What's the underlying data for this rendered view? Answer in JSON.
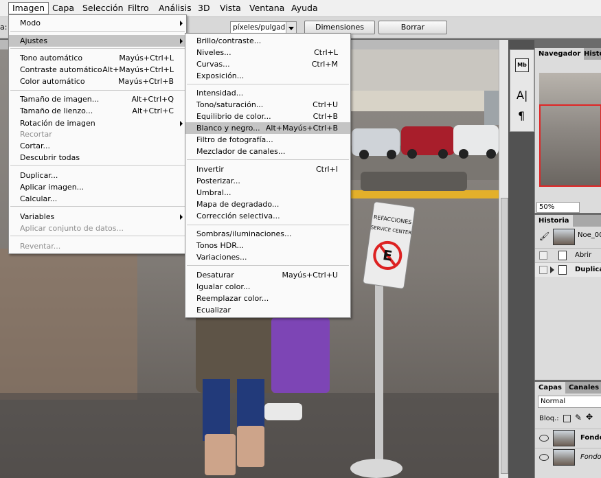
{
  "menubar": {
    "items": [
      "Imagen",
      "Capa",
      "Selección",
      "Filtro",
      "Análisis",
      "3D",
      "Vista",
      "Ventana",
      "Ayuda"
    ],
    "active": "Imagen"
  },
  "optbar": {
    "unit_select": "píxeles/pulgada",
    "dimensions_button": "Dimensiones",
    "clear_button": "Borrar",
    "left_label": "a:"
  },
  "imagen_menu": {
    "items": [
      {
        "label": "Modo",
        "shortcut": "",
        "submenu": true
      },
      {
        "label": "Ajustes",
        "shortcut": "",
        "submenu": true,
        "highlight": true
      },
      {
        "label": "Tono automático",
        "shortcut": "Mayús+Ctrl+L"
      },
      {
        "label": "Contraste automático",
        "shortcut": "Alt+Mayús+Ctrl+L"
      },
      {
        "label": "Color automático",
        "shortcut": "Mayús+Ctrl+B"
      },
      {
        "label": "Tamaño de imagen...",
        "shortcut": "Alt+Ctrl+Q"
      },
      {
        "label": "Tamaño de lienzo...",
        "shortcut": "Alt+Ctrl+C"
      },
      {
        "label": "Rotación de imagen",
        "shortcut": "",
        "submenu": true
      },
      {
        "label": "Recortar",
        "shortcut": "",
        "disabled": true
      },
      {
        "label": "Cortar...",
        "shortcut": ""
      },
      {
        "label": "Descubrir todas",
        "shortcut": ""
      },
      {
        "label": "Duplicar...",
        "shortcut": ""
      },
      {
        "label": "Aplicar imagen...",
        "shortcut": ""
      },
      {
        "label": "Calcular...",
        "shortcut": ""
      },
      {
        "label": "Variables",
        "shortcut": "",
        "submenu": true
      },
      {
        "label": "Aplicar conjunto de datos...",
        "shortcut": "",
        "disabled": true
      },
      {
        "label": "Reventar...",
        "shortcut": "",
        "disabled": true
      }
    ]
  },
  "ajustes_menu": {
    "items": [
      {
        "label": "Brillo/contraste...",
        "shortcut": ""
      },
      {
        "label": "Niveles...",
        "shortcut": "Ctrl+L"
      },
      {
        "label": "Curvas...",
        "shortcut": "Ctrl+M"
      },
      {
        "label": "Exposición...",
        "shortcut": ""
      },
      {
        "label": "Intensidad...",
        "shortcut": ""
      },
      {
        "label": "Tono/saturación...",
        "shortcut": "Ctrl+U"
      },
      {
        "label": "Equilibrio de color...",
        "shortcut": "Ctrl+B"
      },
      {
        "label": "Blanco y negro...",
        "shortcut": "Alt+Mayús+Ctrl+B",
        "highlight": true
      },
      {
        "label": "Filtro de fotografía...",
        "shortcut": ""
      },
      {
        "label": "Mezclador de canales...",
        "shortcut": ""
      },
      {
        "label": "Invertir",
        "shortcut": "Ctrl+I"
      },
      {
        "label": "Posterizar...",
        "shortcut": ""
      },
      {
        "label": "Umbral...",
        "shortcut": ""
      },
      {
        "label": "Mapa de degradado...",
        "shortcut": ""
      },
      {
        "label": "Corrección selectiva...",
        "shortcut": ""
      },
      {
        "label": "Sombras/iluminaciones...",
        "shortcut": ""
      },
      {
        "label": "Tonos HDR...",
        "shortcut": ""
      },
      {
        "label": "Variaciones...",
        "shortcut": ""
      },
      {
        "label": "Desaturar",
        "shortcut": "Mayús+Ctrl+U"
      },
      {
        "label": "Igualar color...",
        "shortcut": ""
      },
      {
        "label": "Reemplazar color...",
        "shortcut": ""
      },
      {
        "label": "Ecualizar",
        "shortcut": ""
      }
    ]
  },
  "navigator": {
    "tabs": [
      "Navegador",
      "Histo"
    ],
    "zoom": "50%"
  },
  "history": {
    "title": "Historia",
    "snapshot": "Noe_00",
    "steps": [
      "Abrir",
      "Duplicar"
    ]
  },
  "layers": {
    "tabs": [
      "Capas",
      "Canales"
    ],
    "blend_mode": "Normal",
    "lock_label": "Bloq.:",
    "rows": [
      "Fondo",
      "Fondo"
    ]
  },
  "tool_icons": [
    "mini-bridge-icon",
    "character-icon",
    "paragraph-icon"
  ],
  "sign": {
    "line1": "REFACCIONES",
    "line2": "SERVICE CENTER",
    "letter": "E"
  },
  "colors": {
    "menu_bg": "#fafafa",
    "highlight": "#c4c4c4",
    "panel_bg": "#dcdcdc"
  }
}
